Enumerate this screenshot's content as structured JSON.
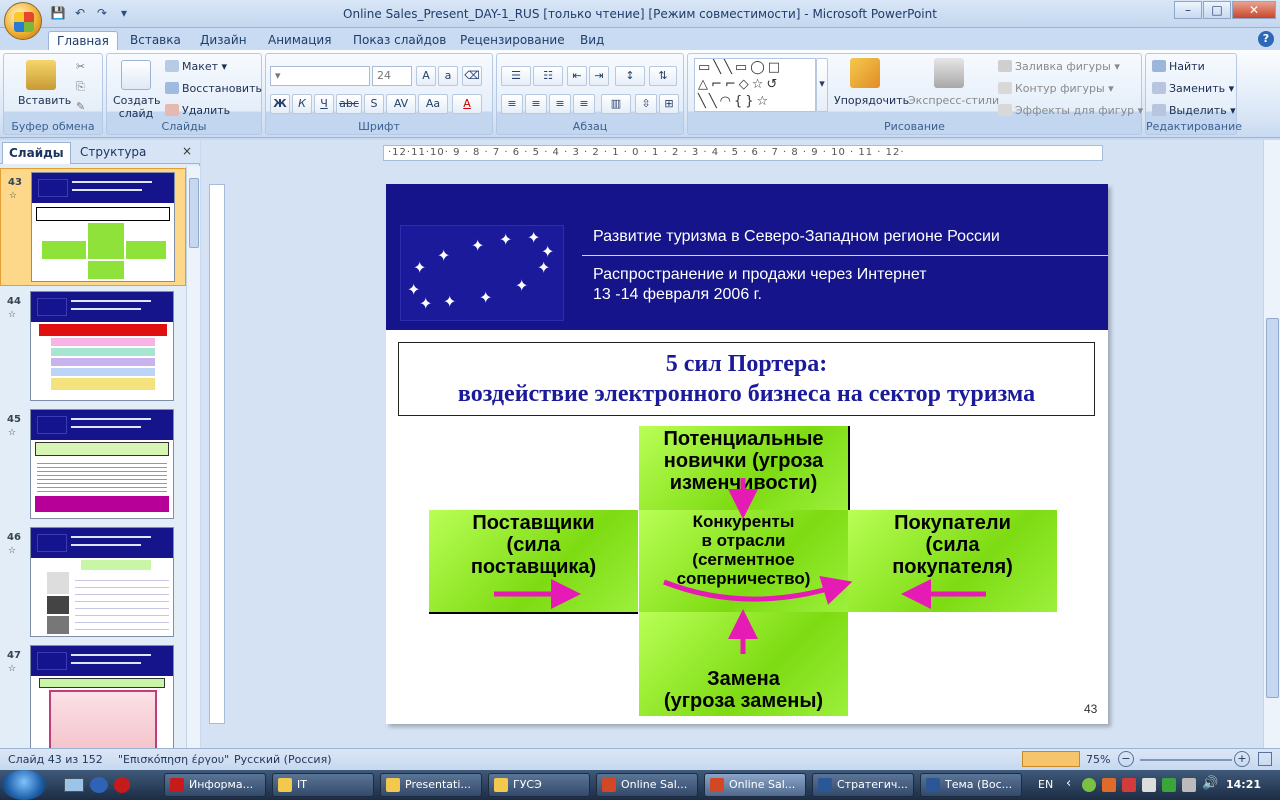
{
  "window": {
    "title": "Online Sales_Present_DAY-1_RUS [только чтение] [Режим совместимости] - Microsoft PowerPoint"
  },
  "ribbon_tabs": [
    "Главная",
    "Вставка",
    "Дизайн",
    "Анимация",
    "Показ слайдов",
    "Рецензирование",
    "Вид"
  ],
  "ribbon": {
    "clipboard": {
      "paste": "Вставить",
      "label": "Буфер обмена"
    },
    "slides": {
      "create": "Создать слайд",
      "layout": "Макет",
      "reset": "Восстановить",
      "delete": "Удалить",
      "label": "Слайды"
    },
    "font": {
      "size": "24",
      "label": "Шрифт"
    },
    "paragraph": {
      "label": "Абзац"
    },
    "drawing": {
      "arrange": "Упорядочить",
      "quick_styles": "Экспресс-стили",
      "fill": "Заливка фигуры",
      "outline": "Контур фигуры",
      "effects": "Эффекты для фигур",
      "label": "Рисование"
    },
    "editing": {
      "find": "Найти",
      "replace": "Заменить",
      "select": "Выделить",
      "label": "Редактирование"
    }
  },
  "panel": {
    "tab_slides": "Слайды",
    "tab_outline": "Структура",
    "close": "×"
  },
  "thumbnails": [
    {
      "num": "43"
    },
    {
      "num": "44"
    },
    {
      "num": "45"
    },
    {
      "num": "46"
    },
    {
      "num": "47"
    }
  ],
  "ruler_text": "·12·11·10· 9 · 8 · 7 · 6 · 5 · 4 · 3 · 2 · 1 · 0 · 1 · 2 · 3 · 4 · 5 · 6 · 7 · 8 · 9 · 10 · 11 · 12·",
  "slide": {
    "header_title": "Развитие туризма в Северо-Западном регионе России",
    "header_line1": "Распространение и продажи через Интернет",
    "header_line2": "13 -14 февраля 2006 г.",
    "title_line1": "5 сил Портера:",
    "title_line2": "воздействие электронного бизнеса на сектор туризма",
    "top_box_1": "Потенциальные",
    "top_box_2": "новички (угроза",
    "top_box_3": "изменчивости)",
    "left_box_1": "Поставщики",
    "left_box_2": "(сила",
    "left_box_3": "поставщика)",
    "center_box_1": "Конкуренты",
    "center_box_2": "в отрасли",
    "center_box_3": "(сегментное",
    "center_box_4": "соперничество)",
    "right_box_1": "Покупатели",
    "right_box_2": "(сила",
    "right_box_3": "покупателя)",
    "bottom_box_1": "Замена",
    "bottom_box_2": "(угроза замены)",
    "page_number": "43"
  },
  "status": {
    "slide_info": "Слайд 43 из 152",
    "theme": "\"Επισκόπηση έργου\"",
    "language": "Русский (Россия)",
    "zoom": "75%"
  },
  "taskbar": {
    "items": [
      "Информа...",
      "IT",
      "Presentati...",
      "ГУСЭ",
      "Online Sal...",
      "Online Sal...",
      "Стратегич...",
      "Тема (Вос..."
    ],
    "lang": "EN",
    "time": "14:21"
  }
}
